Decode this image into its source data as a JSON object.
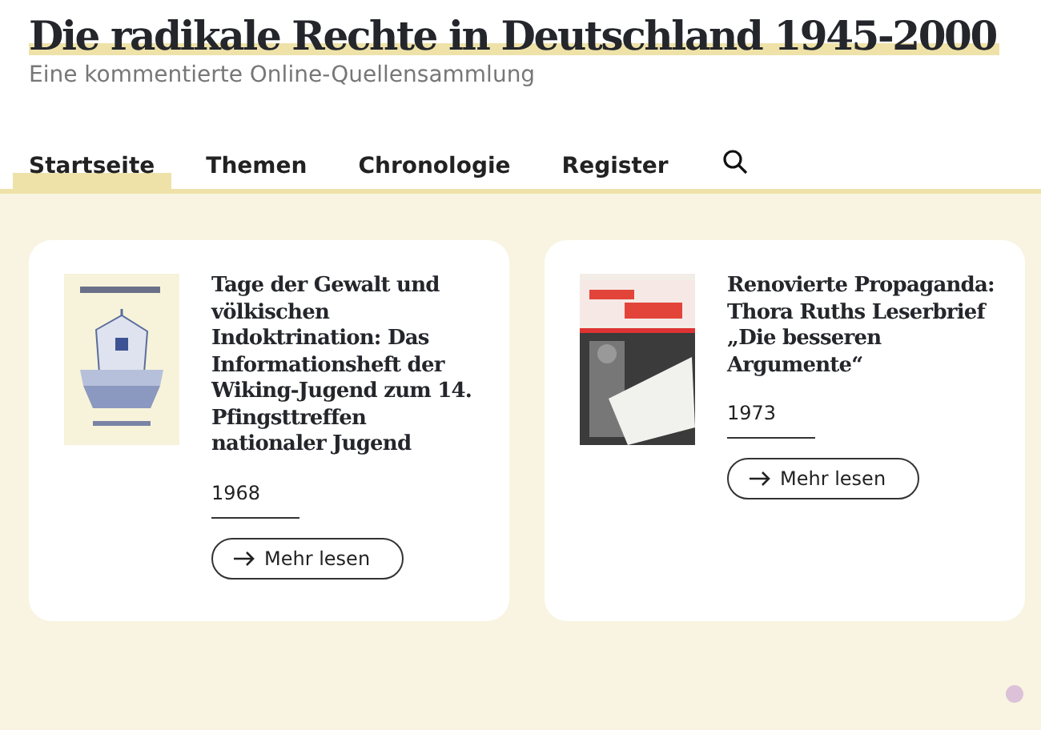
{
  "site": {
    "title": "Die radikale Rechte in Deutschland 1945-2000",
    "subtitle": "Eine kommentierte Online-Quellensammlung"
  },
  "nav": [
    {
      "label": "Startseite",
      "selected": true
    },
    {
      "label": "Themen",
      "selected": false
    },
    {
      "label": "Chronologie",
      "selected": false
    },
    {
      "label": "Register",
      "selected": false
    }
  ],
  "cards": [
    {
      "title": "Tage der Gewalt und völkischen Indoktrination: Das Informationsheft der Wiking-Jugend zum 14. Pfingsttreffen nationaler Jugend",
      "year": "1968",
      "button": "Mehr lesen"
    },
    {
      "title": "Renovierte Propaganda: Thora Ruths Leserbrief „Die besseren Argumente“",
      "year": "1973",
      "button": "Mehr lesen"
    }
  ]
}
